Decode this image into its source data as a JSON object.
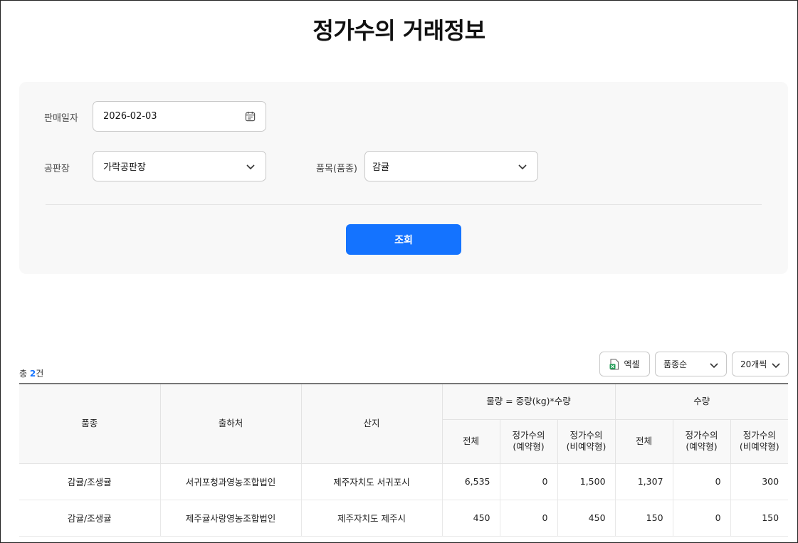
{
  "page": {
    "title": "정가수의 거래정보"
  },
  "filters": {
    "sale_date": {
      "label": "판매일자",
      "value": "2026-02-03"
    },
    "market": {
      "label": "공판장",
      "value": "가락공판장"
    },
    "item": {
      "label": "품목(품종)",
      "value": "감귤"
    },
    "search_label": "조회",
    "accent_color": "#1473ff"
  },
  "results": {
    "total_prefix": "총 ",
    "total_count": "2",
    "total_suffix": "건",
    "excel_label": "엑셀",
    "sort_value": "품종순",
    "page_size_value": "20개씩"
  },
  "table": {
    "headers": {
      "variety": "품종",
      "shipper": "출하처",
      "origin": "산지",
      "volume_group": "물량 = 중량(kg)*수량",
      "quantity_group": "수량",
      "total": "전체",
      "reserved_1": "정가수의",
      "reserved_2": "(예약형)",
      "nonreserved_1": "정가수의",
      "nonreserved_2": "(비예약형)"
    },
    "rows": [
      {
        "variety": "감귤/조생귤",
        "shipper": "서귀포청과영농조합법인",
        "origin": "제주자치도 서귀포시",
        "vol_total": "6,535",
        "vol_reserved": "0",
        "vol_nonreserved": "1,500",
        "qty_total": "1,307",
        "qty_reserved": "0",
        "qty_nonreserved": "300"
      },
      {
        "variety": "감귤/조생귤",
        "shipper": "제주귤사랑영농조합법인",
        "origin": "제주자치도 제주시",
        "vol_total": "450",
        "vol_reserved": "0",
        "vol_nonreserved": "450",
        "qty_total": "150",
        "qty_reserved": "0",
        "qty_nonreserved": "150"
      }
    ]
  }
}
